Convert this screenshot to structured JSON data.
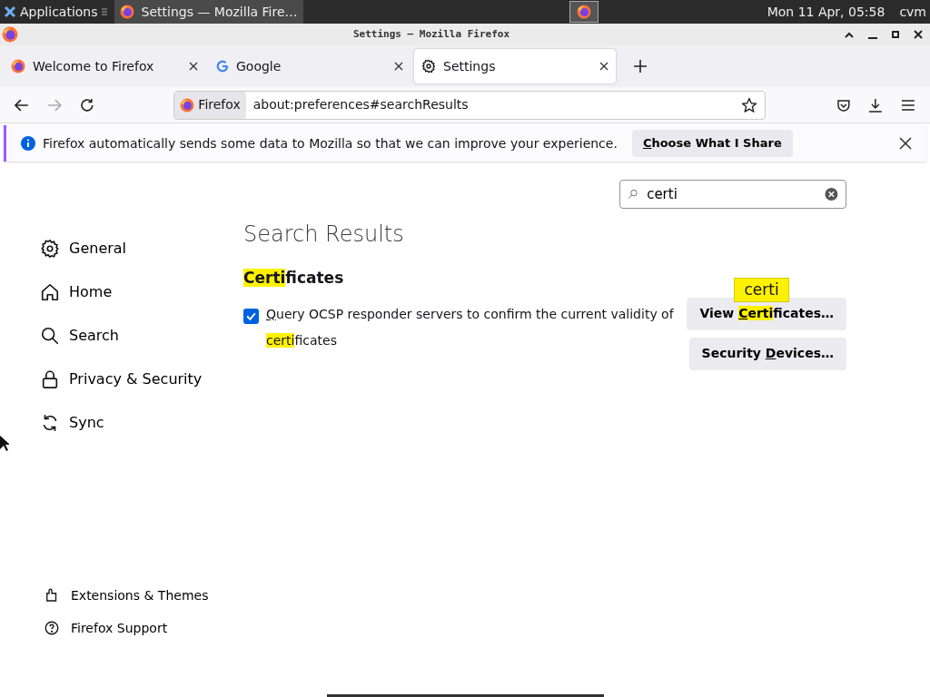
{
  "taskbar": {
    "apps_label": "Applications",
    "window_button": {
      "title": "Settings — Mozilla Fire…",
      "selected": true
    },
    "clock": "Mon 11 Apr, 05:58",
    "user": "cvm"
  },
  "window": {
    "title": "Settings — Mozilla Firefox"
  },
  "tabs": [
    {
      "label": "Welcome to Firefox",
      "selected": false
    },
    {
      "label": "Google",
      "selected": false
    },
    {
      "label": "Settings",
      "selected": true
    }
  ],
  "navbar": {
    "identity_label": "Firefox",
    "url": "about:preferences#searchResults"
  },
  "notification": {
    "message": "Firefox automatically sends some data to Mozilla so that we can improve your experience.",
    "button": [
      {
        "text": "C",
        "underlined": true
      },
      {
        "text": "hoose What I Share"
      }
    ]
  },
  "search": {
    "value": "certi"
  },
  "sidebar": {
    "items": [
      {
        "label": "General"
      },
      {
        "label": "Home"
      },
      {
        "label": "Search"
      },
      {
        "label": "Privacy & Security"
      },
      {
        "label": "Sync"
      }
    ]
  },
  "footer_links": [
    {
      "label": "Extensions & Themes"
    },
    {
      "label": "Firefox Support"
    }
  ],
  "results": {
    "title": "Search Results",
    "heading": [
      {
        "text": "Certi",
        "highlighted": true
      },
      {
        "text": "ficates"
      }
    ],
    "checkbox": {
      "checked": true,
      "label": [
        {
          "text": "Q",
          "underlined": true
        },
        {
          "text": "uery OCSP responder servers to confirm the current validity of "
        },
        {
          "text": "certi",
          "highlighted": true
        },
        {
          "text": "ficates"
        }
      ]
    },
    "buttons": [
      {
        "parts": [
          {
            "text": "View "
          },
          {
            "text": "C",
            "underlined": true,
            "highlighted": true
          },
          {
            "text": "erti",
            "highlighted": true
          },
          {
            "text": "ficates…"
          }
        ]
      },
      {
        "parts": [
          {
            "text": "Security "
          },
          {
            "text": "D",
            "underlined": true
          },
          {
            "text": "evices…"
          }
        ]
      }
    ],
    "tooltip": "certi"
  }
}
